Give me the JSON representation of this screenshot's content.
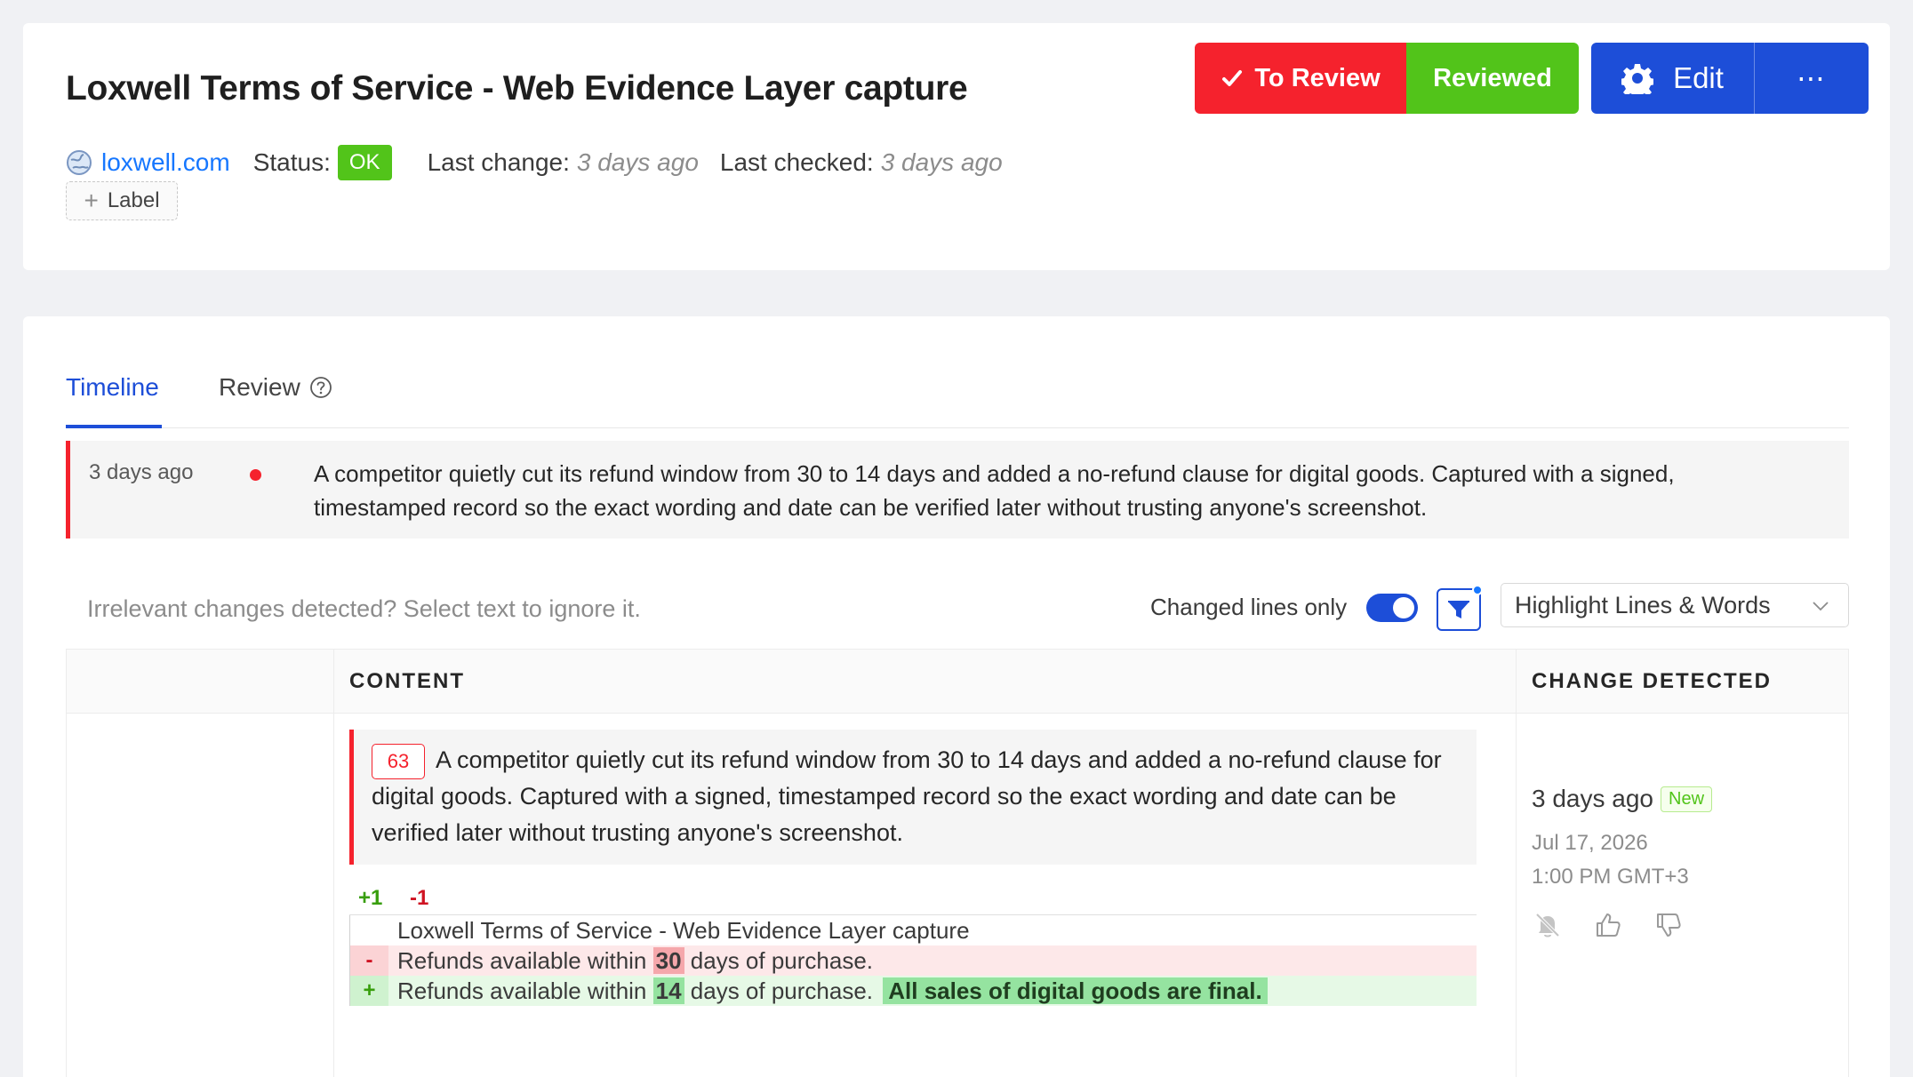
{
  "header": {
    "title": "Loxwell Terms of Service - Web Evidence Layer capture",
    "site": "loxwell.com",
    "status_label": "Status:",
    "status_value": "OK",
    "last_change_label": "Last change:",
    "last_change_value": "3 days ago",
    "last_checked_label": "Last checked:",
    "last_checked_value": "3 days ago",
    "label_button": "Label",
    "to_review_button": "To Review",
    "reviewed_button": "Reviewed",
    "edit_button": "Edit",
    "more_button": "⋯"
  },
  "tabs": [
    {
      "label": "Timeline",
      "active": true
    },
    {
      "label": "Review",
      "active": false
    }
  ],
  "event": {
    "time": "3 days ago",
    "text": "A competitor quietly cut its refund window from 30 to 14 days and added a no-refund clause for digital goods. Captured with a signed, timestamped record so the exact wording and date can be verified later without trusting anyone's screenshot."
  },
  "filters": {
    "hint": "Irrelevant changes detected? Select text to ignore it.",
    "changed_lines_label": "Changed lines only",
    "changed_lines_on": true,
    "highlight_mode": "Highlight Lines & Words"
  },
  "table": {
    "col_content": "CONTENT",
    "col_change": "CHANGE DETECTED",
    "row": {
      "line_number": "63",
      "text": "A competitor quietly cut its refund window from 30 to 14 days and added a no-refund clause for digital goods. Captured with a signed, timestamped record so the exact wording and date can be verified later without trusting anyone's screenshot.",
      "added_count": "+1",
      "removed_count": "-1",
      "diff": {
        "context": "Loxwell Terms of Service - Web Evidence Layer capture",
        "del_marker": "-",
        "del_prefix": "Refunds available within",
        "del_word": "30",
        "del_suffix": "days of purchase.",
        "add_marker": "+",
        "add_prefix": "Refunds available within",
        "add_word": "14",
        "add_suffix": "days of purchase.",
        "add_block": "All sales of digital goods are final."
      },
      "detected_relative": "3 days ago",
      "detected_badge": "New",
      "detected_date": "Jul 17, 2026",
      "detected_time": "1:00 PM GMT+3"
    }
  },
  "colors": {
    "accent": "#1d4ed8",
    "danger": "#f5222d",
    "success": "#52c41a",
    "link": "#1677ff"
  },
  "icons": {
    "site": "globe-icon",
    "review_check": "check-icon",
    "edit": "gear-icon",
    "help": "question-circle-icon",
    "filter": "funnel-icon",
    "select": "chevron-down-icon",
    "mute": "bell-off-icon",
    "like": "thumbs-up-icon",
    "dislike": "thumbs-down-icon"
  }
}
